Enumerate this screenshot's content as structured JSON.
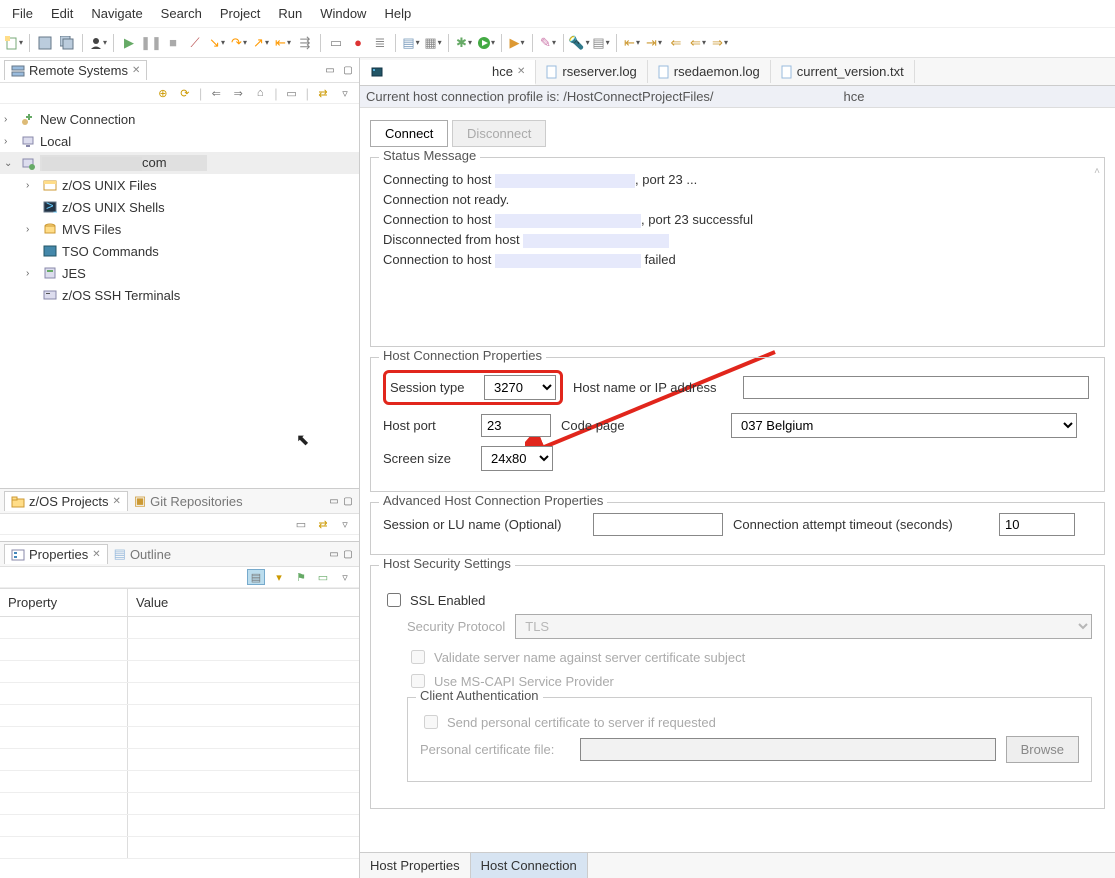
{
  "menu": {
    "file": "File",
    "edit": "Edit",
    "navigate": "Navigate",
    "search": "Search",
    "project": "Project",
    "run": "Run",
    "window": "Window",
    "help": "Help"
  },
  "remoteSystems": {
    "title": "Remote Systems",
    "items": [
      {
        "label": "New Connection"
      },
      {
        "label": "Local"
      },
      {
        "label": "com",
        "masked": true
      },
      {
        "label": "z/OS UNIX Files"
      },
      {
        "label": "z/OS UNIX Shells"
      },
      {
        "label": "MVS Files"
      },
      {
        "label": "TSO Commands"
      },
      {
        "label": "JES"
      },
      {
        "label": "z/OS SSH Terminals"
      }
    ]
  },
  "lowerLeft": {
    "projectsTab": "z/OS Projects",
    "gitTab": "Git Repositories",
    "propsTab": "Properties",
    "outlineTab": "Outline",
    "propHead": "Property",
    "valHead": "Value"
  },
  "editor": {
    "tabs": [
      {
        "label": "hce",
        "active": true
      },
      {
        "label": "rseserver.log"
      },
      {
        "label": "rsedaemon.log"
      },
      {
        "label": "current_version.txt"
      }
    ],
    "crumb_prefix": "Current host connection profile is: /HostConnectProjectFiles/",
    "crumb_suffix": "hce",
    "connect": "Connect",
    "disconnect": "Disconnect",
    "statusTitle": "Status Message",
    "msgs": {
      "m1a": "Connecting to host ",
      "m1b": ", port 23 ...",
      "m2": "Connection not ready.",
      "m3a": "Connection to host ",
      "m3b": ", port 23 successful",
      "m4": "Disconnected from host ",
      "m5a": "Connection to host ",
      "m5b": " failed"
    },
    "hcp": {
      "title": "Host Connection Properties",
      "sessionTypeLbl": "Session type",
      "sessionType": "3270",
      "hostNameLbl": "Host name or IP address",
      "hostName": "",
      "hostPortLbl": "Host port",
      "hostPort": "23",
      "codePageLbl": "Code page",
      "codePage": "037 Belgium",
      "screenSizeLbl": "Screen size",
      "screenSize": "24x80"
    },
    "adv": {
      "title": "Advanced Host Connection Properties",
      "luLbl": "Session or LU name (Optional)",
      "lu": "",
      "timeoutLbl": "Connection attempt timeout (seconds)",
      "timeout": "10"
    },
    "sec": {
      "title": "Host Security Settings",
      "sslLbl": "SSL Enabled",
      "protoLbl": "Security Protocol",
      "proto": "TLS",
      "validateLbl": "Validate server name against server certificate subject",
      "capiLbl": "Use MS-CAPI Service Provider",
      "clientAuth": "Client Authentication",
      "sendCertLbl": "Send personal certificate to server if requested",
      "pcfLbl": "Personal certificate file:",
      "browse": "Browse"
    },
    "bottomTabs": {
      "props": "Host Properties",
      "conn": "Host Connection"
    }
  }
}
